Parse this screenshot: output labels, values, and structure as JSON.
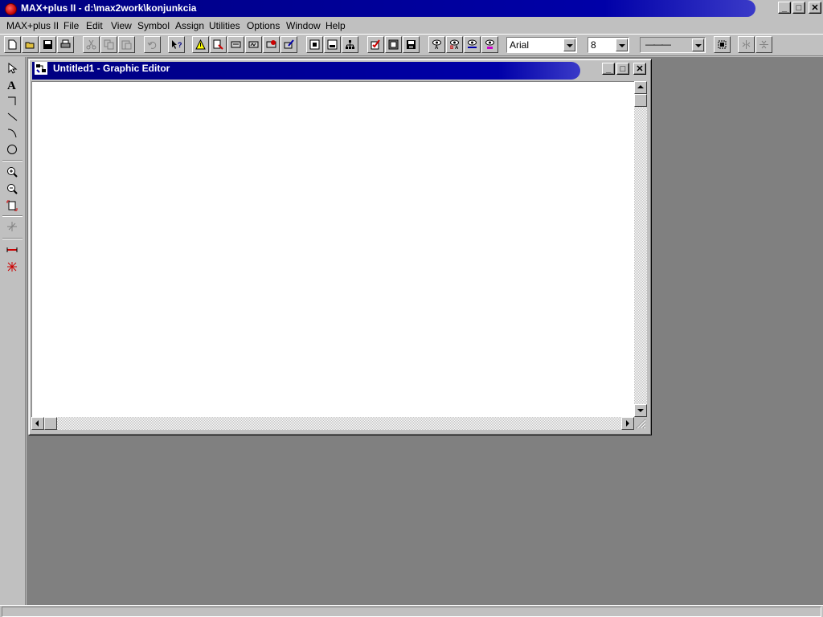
{
  "window": {
    "title": "MAX+plus II - d:\\max2work\\konjunkcia",
    "controls": {
      "minimize": "_",
      "maximize": "□",
      "close": "✕"
    }
  },
  "menu": {
    "items": [
      "MAX+plus II",
      "File",
      "Edit",
      "View",
      "Symbol",
      "Assign",
      "Utilities",
      "Options",
      "Window",
      "Help"
    ]
  },
  "toolbar": {
    "buttons": [
      "new-icon",
      "open-icon",
      "save-icon",
      "print-icon",
      "cut-icon",
      "copy-icon",
      "paste-icon",
      "undo-icon",
      "help-pointer-icon",
      "warning-icon",
      "hierarchy-icon",
      "compiler-icon",
      "simulator-icon",
      "timing-icon",
      "programmer-icon",
      "floorplan-icon",
      "project-icon",
      "hierarchy-tree-icon",
      "check-icon",
      "compile-icon",
      "save-compile-icon",
      "eye-a-icon",
      "eye-ba-icon",
      "eye-line-icon",
      "eye-pin-icon"
    ],
    "font_combo": "Arial",
    "size_combo": "8",
    "line_style_combo": "———"
  },
  "toolbox": {
    "tools": [
      "selection-arrow-icon",
      "text-tool-icon",
      "orthogonal-line-icon",
      "diagonal-line-icon",
      "arc-icon",
      "circle-icon",
      "zoom-in-icon",
      "zoom-out-icon",
      "fit-window-icon",
      "connect-icon",
      "rubberband-icon",
      "junction-icon"
    ]
  },
  "child_window": {
    "title": "Untitled1 - Graphic Editor",
    "controls": {
      "minimize": "_",
      "maximize": "□",
      "close": "✕"
    }
  },
  "status": {
    "text": ""
  }
}
